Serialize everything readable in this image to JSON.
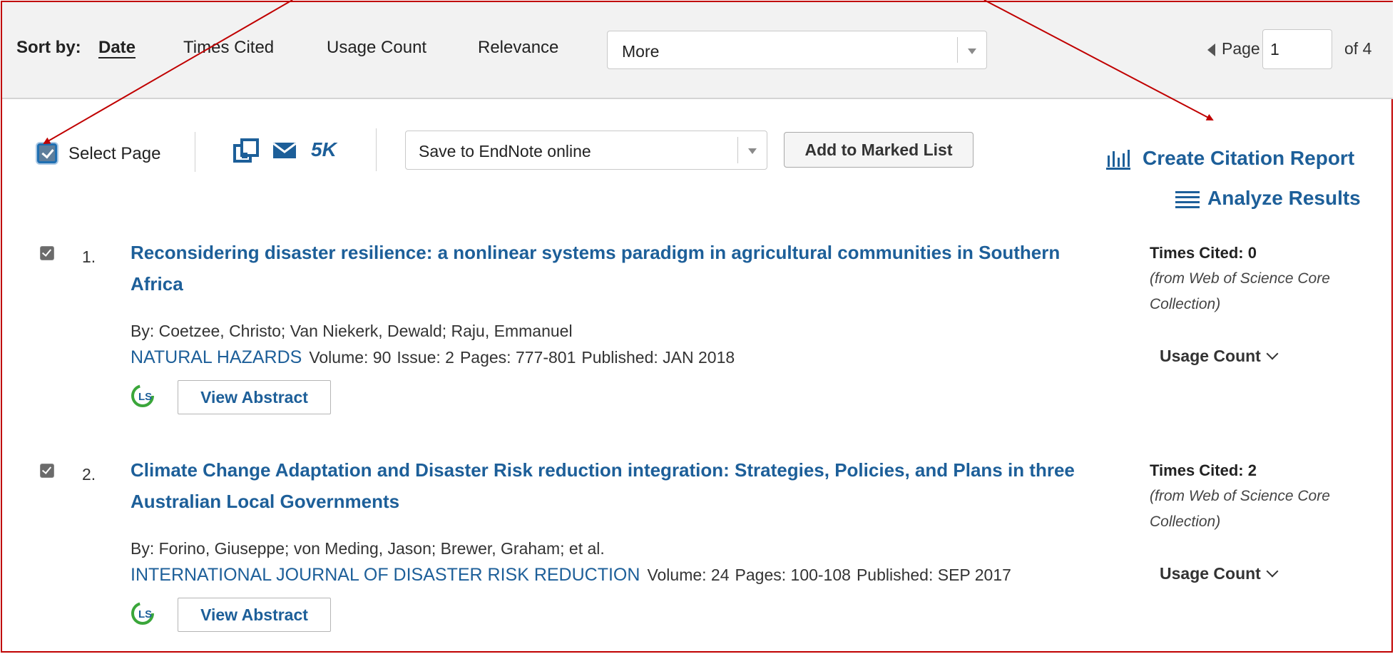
{
  "sort_bar": {
    "label": "Sort by:",
    "options": [
      "Date",
      "Times Cited",
      "Usage Count",
      "Relevance"
    ],
    "active_option": "Date",
    "more_select_value": "More",
    "pager": {
      "label": "Page",
      "current": "1",
      "of_label": "of 4"
    }
  },
  "toolbar": {
    "select_page_label": "Select Page",
    "select_page_checked": true,
    "print_icon": "print-icon",
    "email_icon": "envelope-icon",
    "fivek_label": "5K",
    "save_select_value": "Save to EndNote online",
    "add_marked_label": "Add to Marked List",
    "citation_report_label": "Create Citation Report",
    "analyze_label": "Analyze Results"
  },
  "records": [
    {
      "num": "1.",
      "checked": true,
      "title": "Reconsidering disaster resilience: a nonlinear systems paradigm in agricultural communities in Southern Africa",
      "authors": "By: Coetzee, Christo; Van Niekerk, Dewald; Raju, Emmanuel",
      "journal": "NATURAL HAZARDS",
      "volume": "Volume: 90",
      "issue": "Issue: 2",
      "pages": "Pages: 777-801",
      "published": "Published: JAN 2018",
      "view_abstract_label": "View Abstract",
      "times_cited": "Times Cited: 0",
      "cited_source": "(from Web of Science Core Collection)",
      "usage_label": "Usage Count"
    },
    {
      "num": "2.",
      "checked": true,
      "title": "Climate Change Adaptation and Disaster Risk reduction integration: Strategies, Policies, and Plans in three Australian Local Governments",
      "authors": "By: Forino, Giuseppe; von Meding, Jason; Brewer, Graham; et al.",
      "journal": "INTERNATIONAL JOURNAL OF DISASTER RISK REDUCTION",
      "volume": "Volume: 24",
      "pages": "Pages: 100-108",
      "published": "Published: SEP 2017",
      "view_abstract_label": "View Abstract",
      "times_cited": "Times Cited: 2",
      "cited_source": "(from Web of Science Core Collection)",
      "usage_label": "Usage Count"
    }
  ],
  "colors": {
    "link": "#1d5f99",
    "annotation_border": "#c00000",
    "sortbar_bg": "#f2f2f2"
  }
}
